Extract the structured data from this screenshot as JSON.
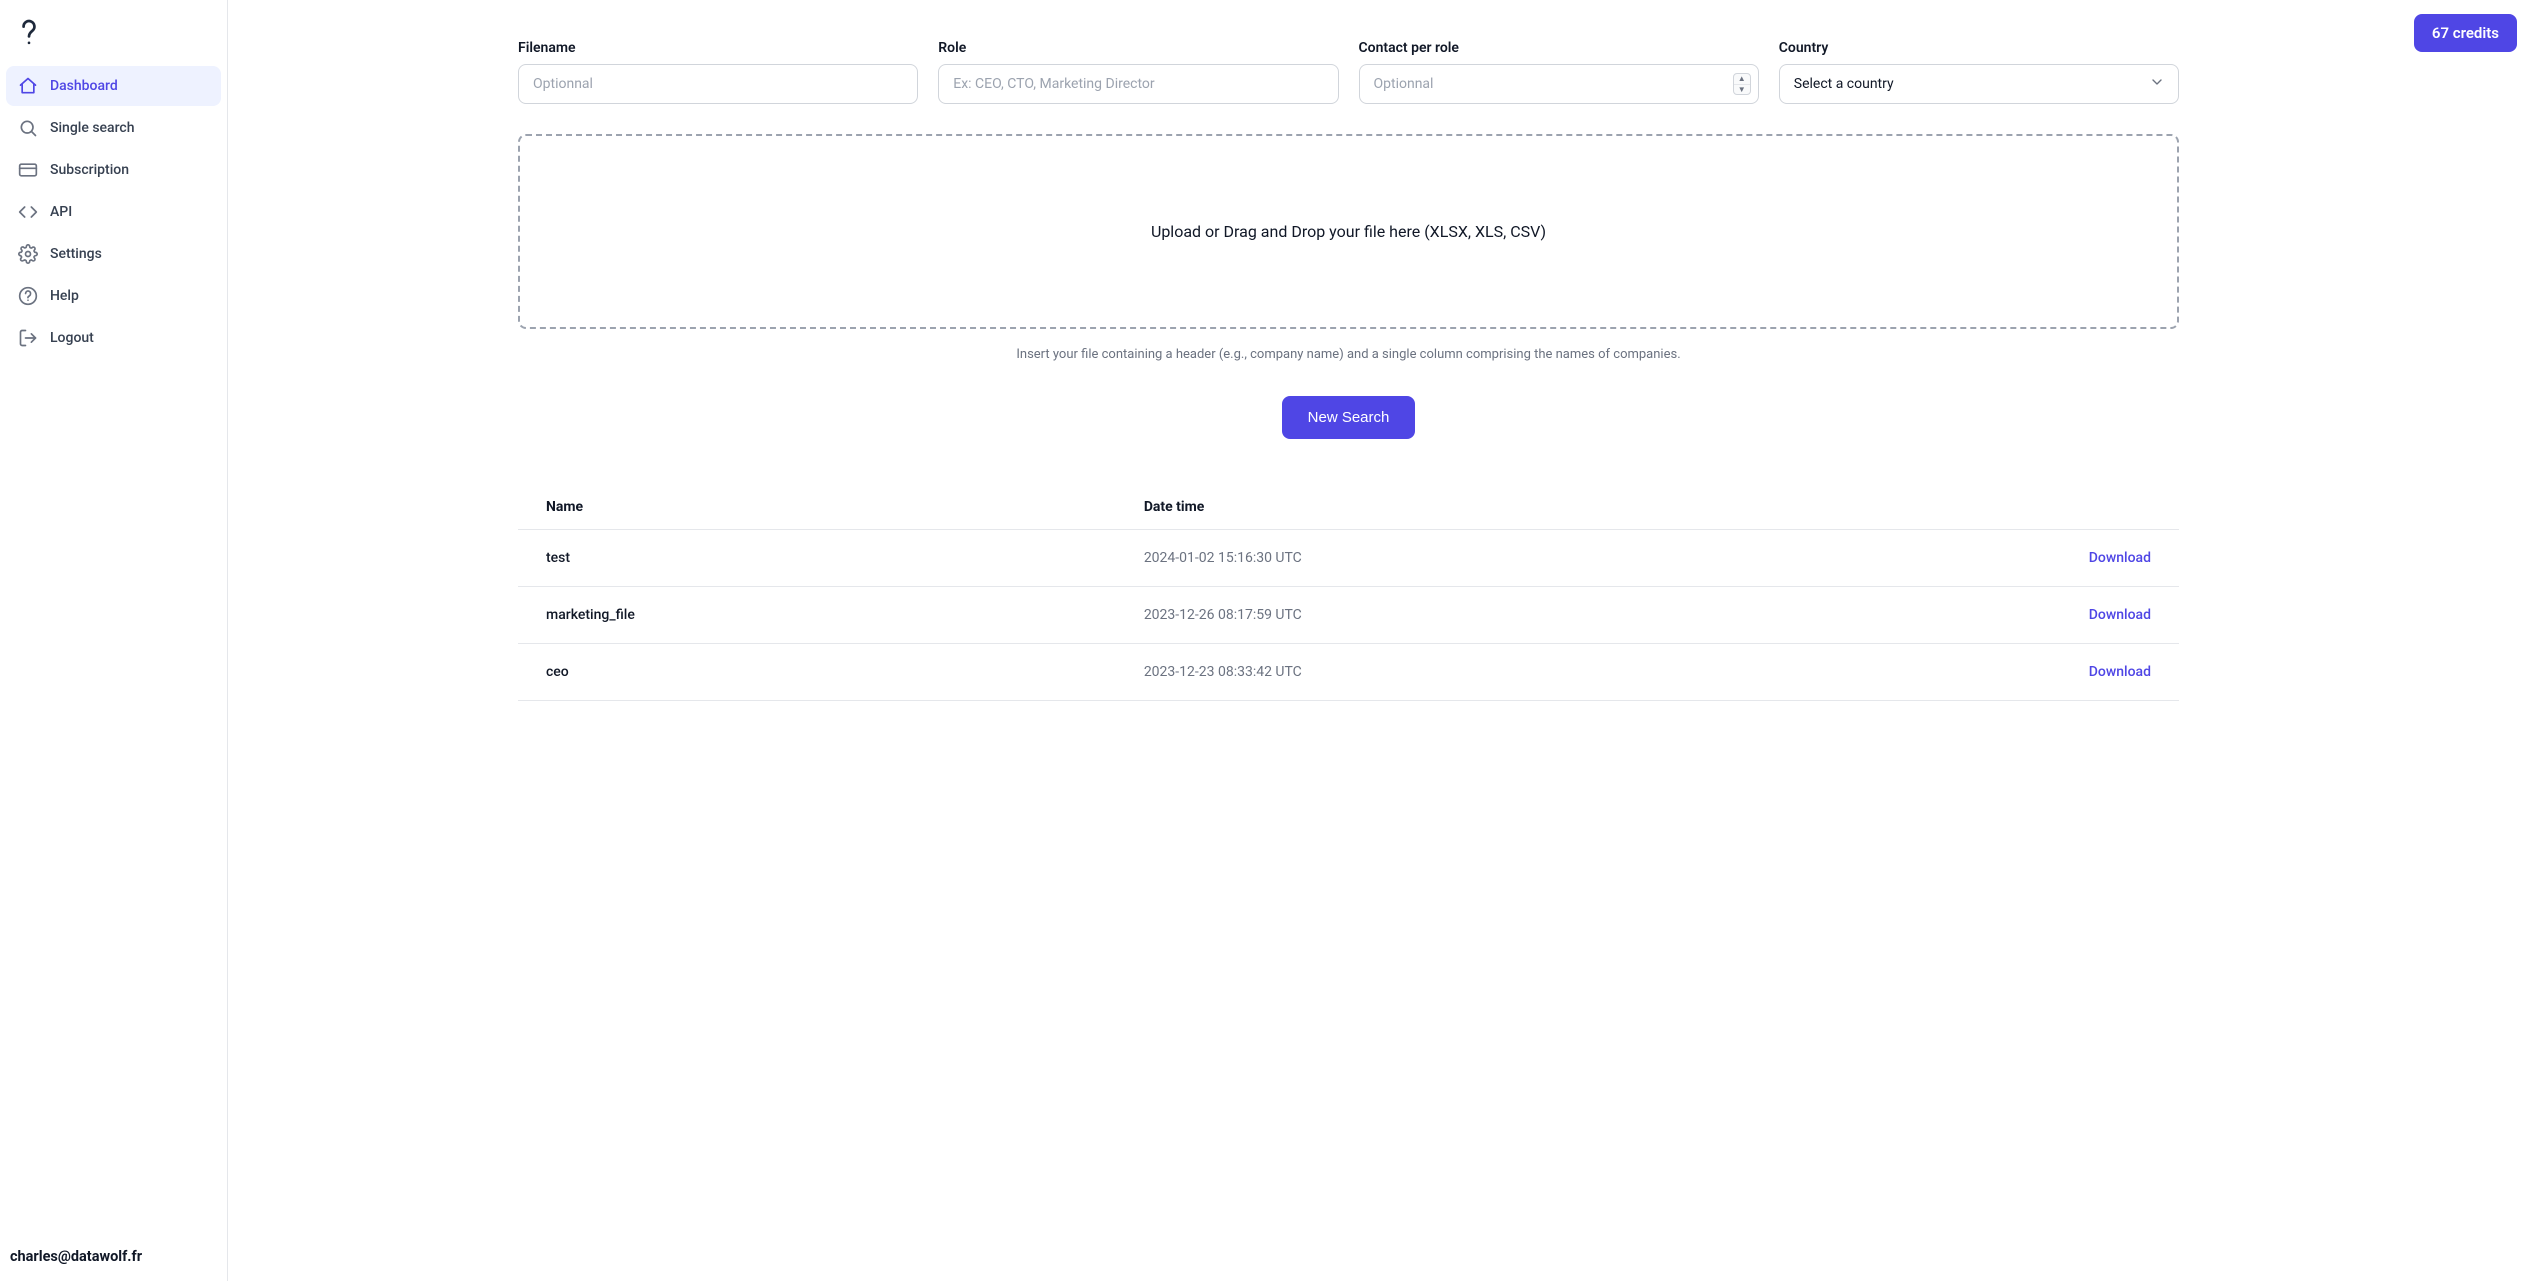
{
  "brand": {
    "accent": "#4f46e5"
  },
  "sidebar": {
    "items": [
      {
        "label": "Dashboard",
        "icon": "home-icon",
        "active": true
      },
      {
        "label": "Single search",
        "icon": "search-icon",
        "active": false
      },
      {
        "label": "Subscription",
        "icon": "credit-card-icon",
        "active": false
      },
      {
        "label": "API",
        "icon": "code-icon",
        "active": false
      },
      {
        "label": "Settings",
        "icon": "gear-icon",
        "active": false
      },
      {
        "label": "Help",
        "icon": "help-icon",
        "active": false
      },
      {
        "label": "Logout",
        "icon": "logout-icon",
        "active": false
      }
    ],
    "footer_email": "charles@datawolf.fr"
  },
  "header": {
    "credits_label": "67 credits"
  },
  "form": {
    "filename": {
      "label": "Filename",
      "placeholder": "Optionnal"
    },
    "role": {
      "label": "Role",
      "placeholder": "Ex: CEO, CTO, Marketing Director"
    },
    "per_role": {
      "label": "Contact per role",
      "placeholder": "Optionnal"
    },
    "country": {
      "label": "Country",
      "placeholder": "Select a country"
    }
  },
  "dropzone": {
    "text": "Upload or Drag and Drop your file here (XLSX, XLS, CSV)",
    "hint": "Insert your file containing a header (e.g., company name) and a single column comprising the names of companies."
  },
  "actions": {
    "new_search": "New Search",
    "download": "Download"
  },
  "table": {
    "columns": {
      "name": "Name",
      "datetime": "Date time"
    },
    "rows": [
      {
        "name": "test",
        "datetime": "2024-01-02 15:16:30 UTC"
      },
      {
        "name": "marketing_file",
        "datetime": "2023-12-26 08:17:59 UTC"
      },
      {
        "name": "ceo",
        "datetime": "2023-12-23 08:33:42 UTC"
      }
    ]
  }
}
